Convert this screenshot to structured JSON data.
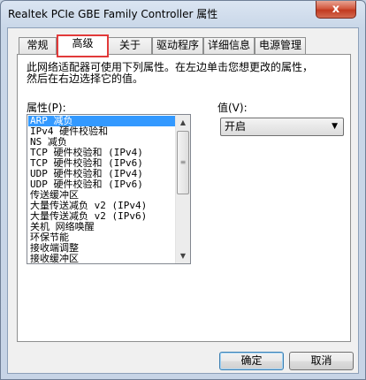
{
  "window": {
    "title": "Realtek PCIe GBE Family Controller 属性",
    "close_glyph": "x"
  },
  "tabs": [
    {
      "label": "常规"
    },
    {
      "label": "高级"
    },
    {
      "label": "关于"
    },
    {
      "label": "驱动程序"
    },
    {
      "label": "详细信息"
    },
    {
      "label": "电源管理"
    }
  ],
  "active_tab": "高级",
  "panel": {
    "description_line1": "此网络适配器可使用下列属性。在左边单击您想更改的属性，",
    "description_line2": "然后在右边选择它的值。",
    "property_label": "属性(P):",
    "value_label": "值(V):"
  },
  "properties": [
    "ARP 减负",
    "IPv4 硬件校验和",
    "NS 减负",
    "TCP 硬件校验和 (IPv4)",
    "TCP 硬件校验和 (IPv6)",
    "UDP 硬件校验和 (IPv4)",
    "UDP 硬件校验和 (IPv6)",
    "传送缓冲区",
    "大量传送减负 v2 (IPv4)",
    "大量传送减负 v2 (IPv6)",
    "关机 网络唤醒",
    "环保节能",
    "接收端调整",
    "接收缓冲区"
  ],
  "selected_property": "ARP 减负",
  "value_select": {
    "selected": "开启"
  },
  "buttons": {
    "ok": "确定",
    "cancel": "取消"
  }
}
